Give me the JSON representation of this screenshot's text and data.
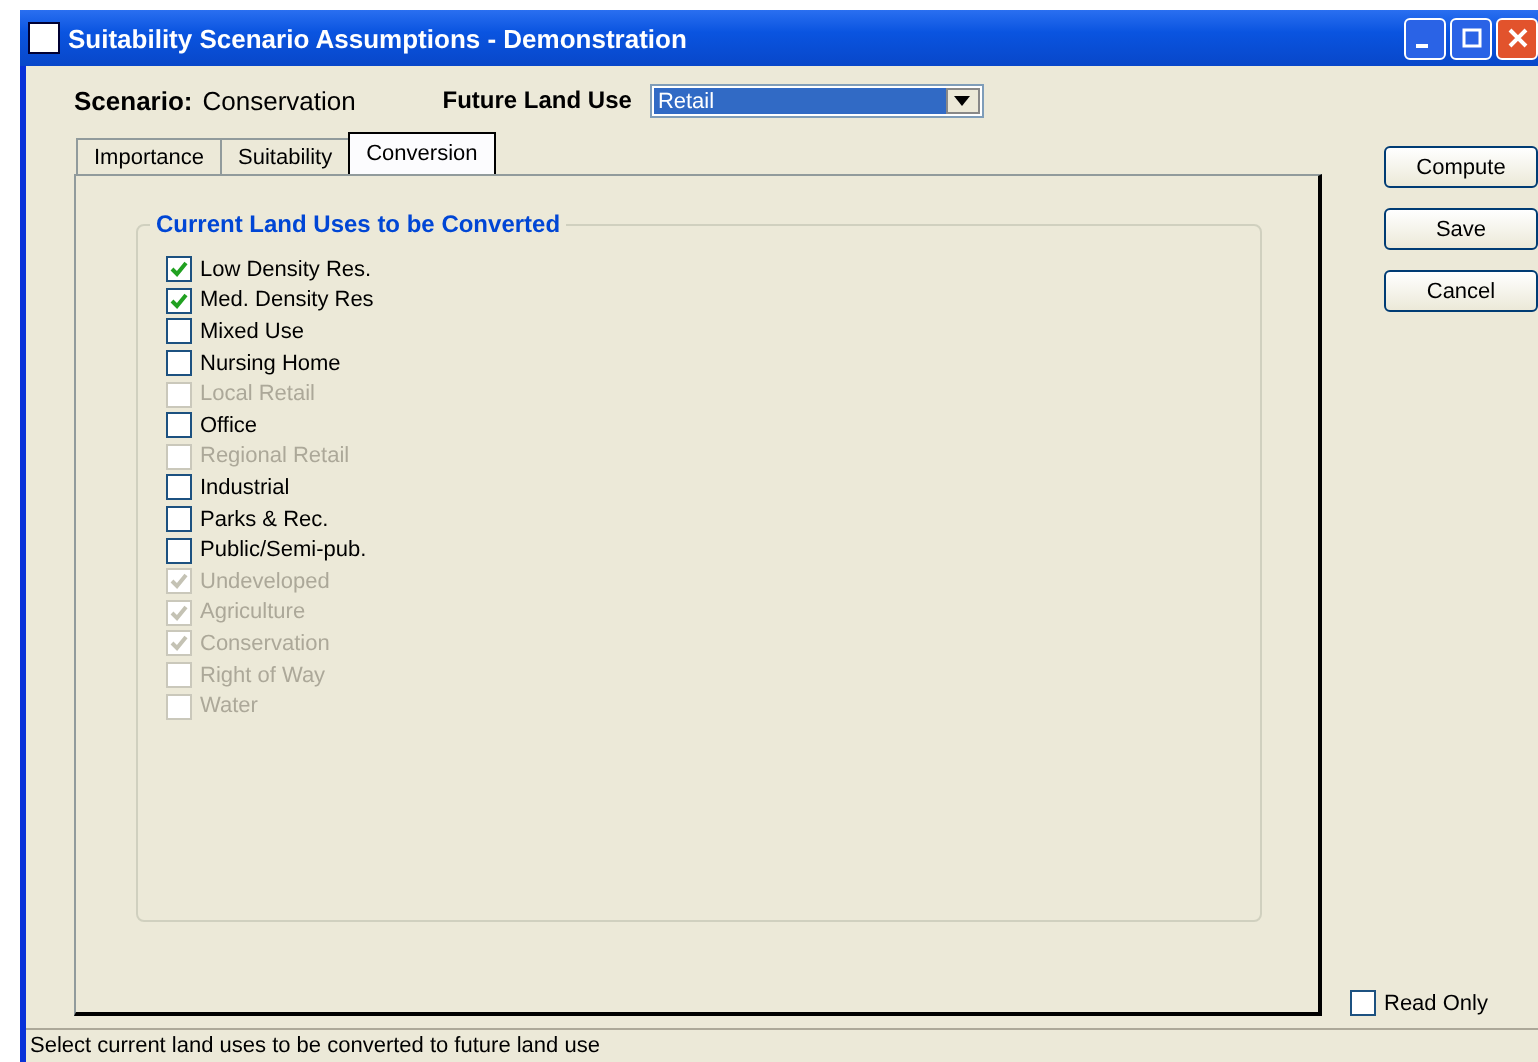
{
  "window": {
    "title": "Suitability Scenario Assumptions - Demonstration"
  },
  "scenario": {
    "label": "Scenario:",
    "value": "Conservation"
  },
  "future_land_use": {
    "label": "Future Land Use",
    "value": "Retail"
  },
  "tabs": [
    {
      "label": "Importance",
      "selected": false
    },
    {
      "label": "Suitability",
      "selected": false
    },
    {
      "label": "Conversion",
      "selected": true
    }
  ],
  "group": {
    "title": "Current Land Uses to be Converted"
  },
  "land_uses": [
    {
      "label": "Low Density Res.",
      "checked": true,
      "disabled": false
    },
    {
      "label": "Med. Density Res",
      "checked": true,
      "disabled": false
    },
    {
      "label": "Mixed Use",
      "checked": false,
      "disabled": false
    },
    {
      "label": "Nursing Home",
      "checked": false,
      "disabled": false
    },
    {
      "label": "Local Retail",
      "checked": false,
      "disabled": true
    },
    {
      "label": "Office",
      "checked": false,
      "disabled": false
    },
    {
      "label": "Regional Retail",
      "checked": false,
      "disabled": true
    },
    {
      "label": "Industrial",
      "checked": false,
      "disabled": false
    },
    {
      "label": "Parks & Rec.",
      "checked": false,
      "disabled": false
    },
    {
      "label": "Public/Semi-pub.",
      "checked": false,
      "disabled": false
    },
    {
      "label": "Undeveloped",
      "checked": true,
      "disabled": true
    },
    {
      "label": "Agriculture",
      "checked": true,
      "disabled": true
    },
    {
      "label": "Conservation",
      "checked": true,
      "disabled": true
    },
    {
      "label": "Right of Way",
      "checked": false,
      "disabled": true
    },
    {
      "label": "Water",
      "checked": false,
      "disabled": true
    }
  ],
  "buttons": [
    "Compute",
    "Save",
    "Cancel"
  ],
  "read_only": {
    "label": "Read Only",
    "checked": false
  },
  "status_bar": "Select current land uses to be converted to future land use"
}
